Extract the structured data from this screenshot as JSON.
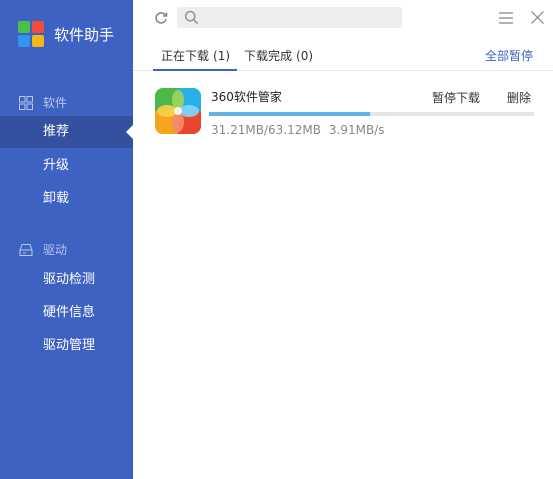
{
  "app": {
    "title": "软件助手"
  },
  "sidebar": {
    "sections": [
      {
        "label": "软件",
        "items": [
          {
            "label": "推荐",
            "active": true
          },
          {
            "label": "升级"
          },
          {
            "label": "卸载"
          }
        ]
      },
      {
        "label": "驱动",
        "items": [
          {
            "label": "驱动检测"
          },
          {
            "label": "硬件信息"
          },
          {
            "label": "驱动管理"
          }
        ]
      }
    ]
  },
  "toolbar": {
    "search_placeholder": "",
    "icons": [
      "refresh-icon",
      "search-icon",
      "menu-icon",
      "close-icon"
    ]
  },
  "tabs": {
    "downloading": {
      "label": "正在下载",
      "count": "(1)"
    },
    "completed": {
      "label": "下载完成",
      "count": "(0)"
    },
    "pause_all": "全部暂停"
  },
  "downloads": [
    {
      "name": "360软件管家",
      "downloaded": "31.21MB/63.12MB",
      "speed": "3.91MB/s",
      "progress": 0.494,
      "pause_label": "暂停下载",
      "delete_label": "删除"
    }
  ],
  "colors": {
    "sidebar": "#3e62c2",
    "sidebar_active": "#33519e",
    "accent": "#3e62c2",
    "progress": "#5fb3e6"
  }
}
